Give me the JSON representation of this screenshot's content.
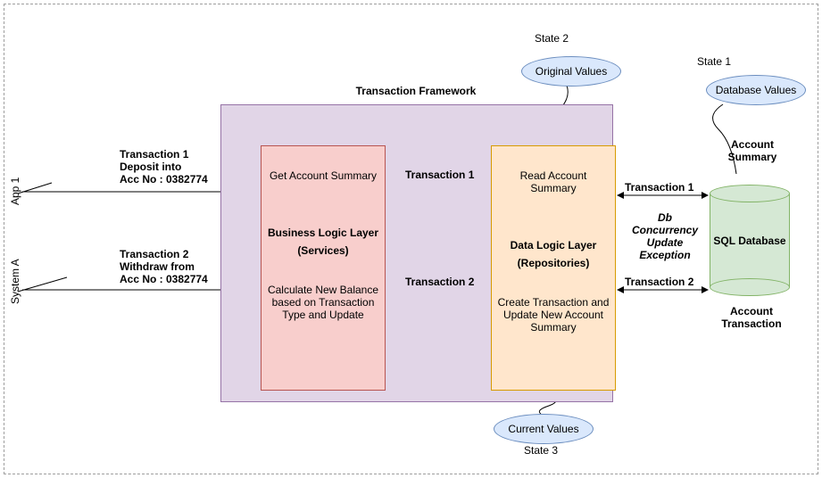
{
  "framework_title": "Transaction Framework",
  "business_layer": {
    "line1": "Get Account Summary",
    "title": "Business Logic Layer",
    "subtitle": "(Services)",
    "line2": "Calculate New Balance based on Transaction Type and Update"
  },
  "data_layer": {
    "line1": "Read Account Summary",
    "title": "Data Logic Layer",
    "subtitle": "(Repositories)",
    "line2": "Create Transaction and Update New Account Summary"
  },
  "database": {
    "label": "SQL Database",
    "top_label": "Account Summary",
    "bottom_label": "Account Transaction",
    "concurrency": "Db Concurrency Update Exception"
  },
  "states": {
    "s1": {
      "label": "State 1",
      "value": "Database Values"
    },
    "s2": {
      "label": "State 2",
      "value": "Original Values"
    },
    "s3": {
      "label": "State 3",
      "value": "Current Values"
    }
  },
  "sources": {
    "app1": "App 1",
    "systemA": "System A"
  },
  "transactions": {
    "t1_desc_l1": "Transaction 1",
    "t1_desc_l2": "Deposit into",
    "t1_desc_l3": "Acc No : 0382774",
    "t2_desc_l1": "Transaction 2",
    "t2_desc_l2": "Withdraw from",
    "t2_desc_l3": "Acc No : 0382774",
    "t1_short": "Transaction 1",
    "t2_short": "Transaction 2"
  }
}
